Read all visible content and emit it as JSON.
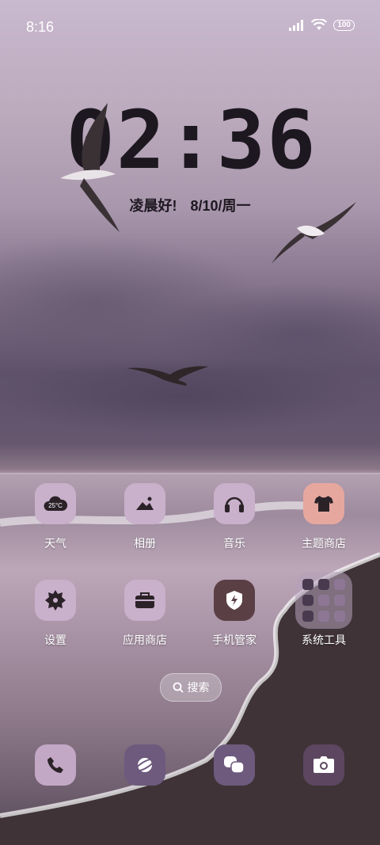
{
  "status_bar": {
    "time": "8:16",
    "battery": "100"
  },
  "clock": {
    "time": "02:36"
  },
  "greeting": {
    "text": "凌晨好!",
    "date": "8/10/周一"
  },
  "weather_widget": {
    "temp": "25°C"
  },
  "apps_row1": [
    {
      "label": "天气",
      "icon": "weather-icon",
      "color": "#c9b0cb"
    },
    {
      "label": "相册",
      "icon": "gallery-icon",
      "color": "#c9b0cb"
    },
    {
      "label": "音乐",
      "icon": "headphones-icon",
      "color": "#c9b0cb"
    },
    {
      "label": "主题商店",
      "icon": "tshirt-icon",
      "color": "#e6a79e"
    }
  ],
  "apps_row2": [
    {
      "label": "设置",
      "icon": "gear-icon",
      "color": "#c9b0cb"
    },
    {
      "label": "应用商店",
      "icon": "store-bag-icon",
      "color": "#c9b0cb"
    },
    {
      "label": "手机管家",
      "icon": "security-shield-icon",
      "color": "#5a3f45"
    },
    {
      "label": "系统工具",
      "icon": "folder-icon",
      "color": "#b39ab5"
    }
  ],
  "search": {
    "label": "搜索"
  },
  "dock": [
    {
      "icon": "phone-icon",
      "color": "#c3a8c5"
    },
    {
      "icon": "browser-planet-icon",
      "color": "#6d5a7d"
    },
    {
      "icon": "messages-icon",
      "color": "#6d5a7d"
    },
    {
      "icon": "camera-icon",
      "color": "#5c4660"
    }
  ]
}
